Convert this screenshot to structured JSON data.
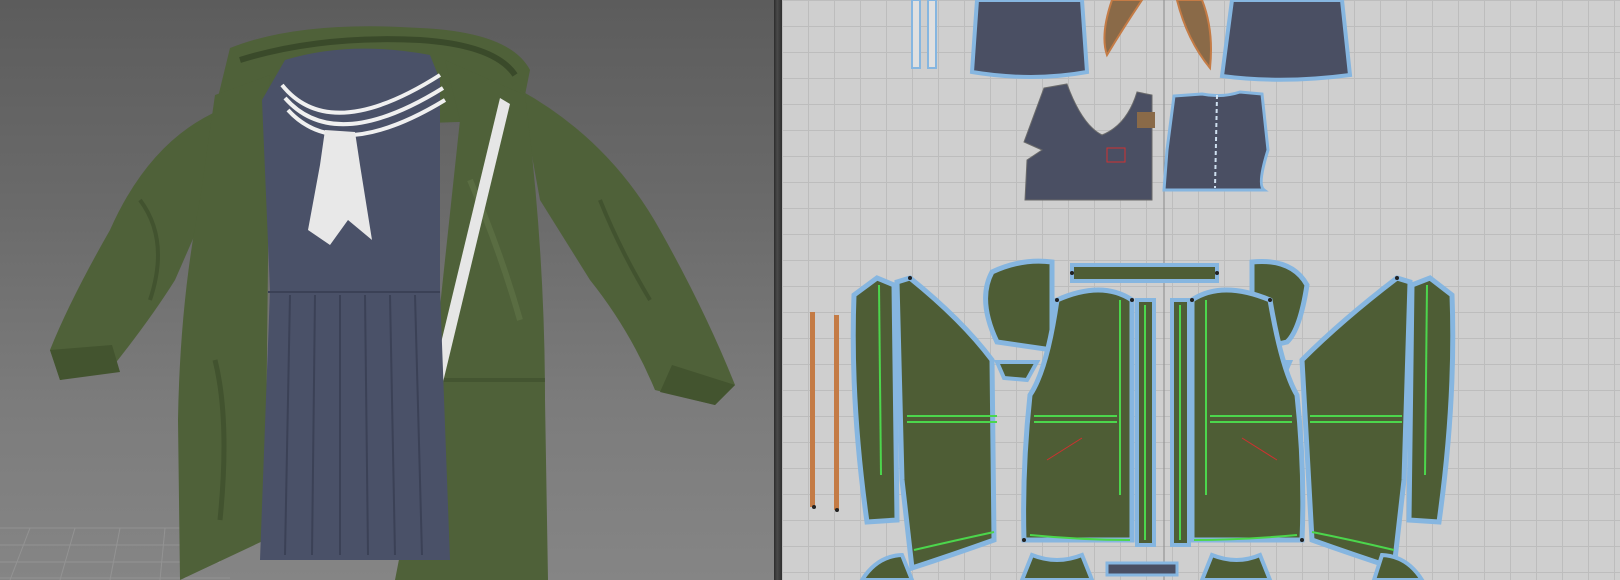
{
  "app": {
    "panels": [
      "3d-garment-view",
      "2d-pattern-view"
    ]
  },
  "view3d": {
    "subject": "avatar-with-coat-and-sailor-uniform",
    "colors": {
      "coat": "#4f6139",
      "coat_shadow": "#3a4a2a",
      "coat_highlight": "#667a4b",
      "uniform": "#4a5168",
      "uniform_dark": "#3b4156",
      "collar_stripe": "#f0f0f0",
      "scarf": "#e8e8e8",
      "zipper": "#e6e6e6"
    }
  },
  "view2d": {
    "colors": {
      "pattern_green": "#4e5d35",
      "pattern_navy": "#4a4f63",
      "pattern_brown": "#8a6a48",
      "outline_selected": "#86b6e0",
      "seam_line": "#4cd64c",
      "strap_orange": "#c47b45",
      "centerline": "#8a8a8a"
    }
  }
}
